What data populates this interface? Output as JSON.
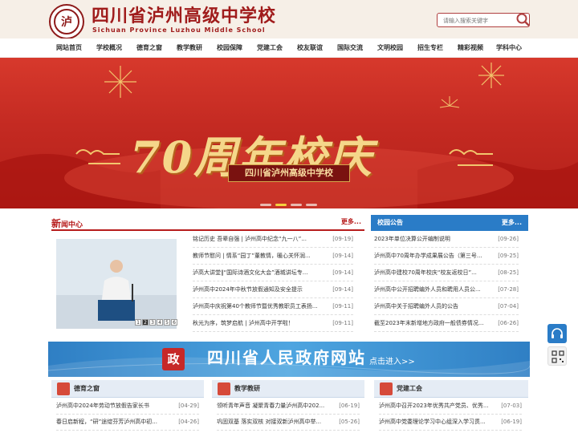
{
  "header": {
    "logo_text": "泸",
    "site_name": "四川省泸州高级中学校",
    "site_name_en": "Sichuan Province Luzhou Middle School",
    "search_placeholder": "请输入搜索关键字"
  },
  "nav": {
    "items": [
      "网站首页",
      "学校概况",
      "德育之窗",
      "教学教研",
      "校园保障",
      "党建工会",
      "校友联谊",
      "国际交流",
      "文明校园",
      "招生专栏",
      "精彩视频",
      "学科中心"
    ]
  },
  "banner": {
    "title": "70周年校庆",
    "ribbon": "四川省泸州高级中学校",
    "slides": 4,
    "active_slide": 1
  },
  "news": {
    "title_big": "新",
    "title_rest": "闻中心",
    "more": "更多...",
    "items": [
      {
        "title": "铭记历史 吾辈自强 | 泸州高中纪念“九一八”...",
        "date": "[09-19]"
      },
      {
        "title": "教师节慰问 | 情系“园丁”董教情，暖心关怀润...",
        "date": "[09-14]"
      },
      {
        "title": "泸高大讲堂‖“国际诗酒文化大会”酒城讲坛专...",
        "date": "[09-14]"
      },
      {
        "title": "泸州高中2024年中秋节放假通知及安全提示",
        "date": "[09-14]"
      },
      {
        "title": "泸州高中庆祝第40个教师节暨优秀教职员工表扬...",
        "date": "[09-11]"
      },
      {
        "title": "秋光为序，筑梦启航 | 泸州高中开学啦！",
        "date": "[09-11]"
      }
    ],
    "photo_pages": [
      "1",
      "2",
      "3",
      "4",
      "5",
      "6"
    ],
    "active_page": 2
  },
  "notice": {
    "title": "校园公告",
    "more": "更多...",
    "items": [
      {
        "title": "2023年单位决算公开编制说明",
        "date": "[09-26]"
      },
      {
        "title": "泸州高中70周年办学成果展公告（第三号...",
        "date": "[09-25]"
      },
      {
        "title": "泸州高中建校70周年校庆“校友返校日”...",
        "date": "[08-25]"
      },
      {
        "title": "泸州高中公开招聘编外人员和聘用人员公...",
        "date": "[07-28]"
      },
      {
        "title": "泸州高中关于招聘编外人员的公告",
        "date": "[07-04]"
      },
      {
        "title": "截至2023年末新增地方政府一般债券情况...",
        "date": "[06-26]"
      }
    ]
  },
  "gov_banner": {
    "seal_text": "政",
    "title": "四川省人民政府网站",
    "enter": "点击进入>>"
  },
  "sub_sections": [
    {
      "title": "德育之窗",
      "items": [
        {
          "title": "泸州高中2024年劳动节放假告家长书",
          "date": "[04-29]"
        },
        {
          "title": "春日启新程，“研”途绽芬芳泸州高中初...",
          "date": "[04-26]"
        }
      ]
    },
    {
      "title": "教学教研",
      "items": [
        {
          "title": "领听青年声音 凝聚青春力量泸州高中202...",
          "date": "[06-19]"
        },
        {
          "title": "巩固双基 落实双核 对接双新泸州高中举...",
          "date": "[05-26]"
        }
      ]
    },
    {
      "title": "党建工会",
      "items": [
        {
          "title": "泸州高中召开2023年优秀共产党员、优秀...",
          "date": "[07-03]"
        },
        {
          "title": "泸州高中党委理论学习中心组深入学习贯...",
          "date": "[06-19]"
        }
      ]
    }
  ],
  "colors": {
    "brand": "#a01c1c",
    "banner_red": "#c42a22",
    "gold": "#f5d78a",
    "notice_blue": "#2a7cc7",
    "gov_blue": "#2f7fc4"
  }
}
